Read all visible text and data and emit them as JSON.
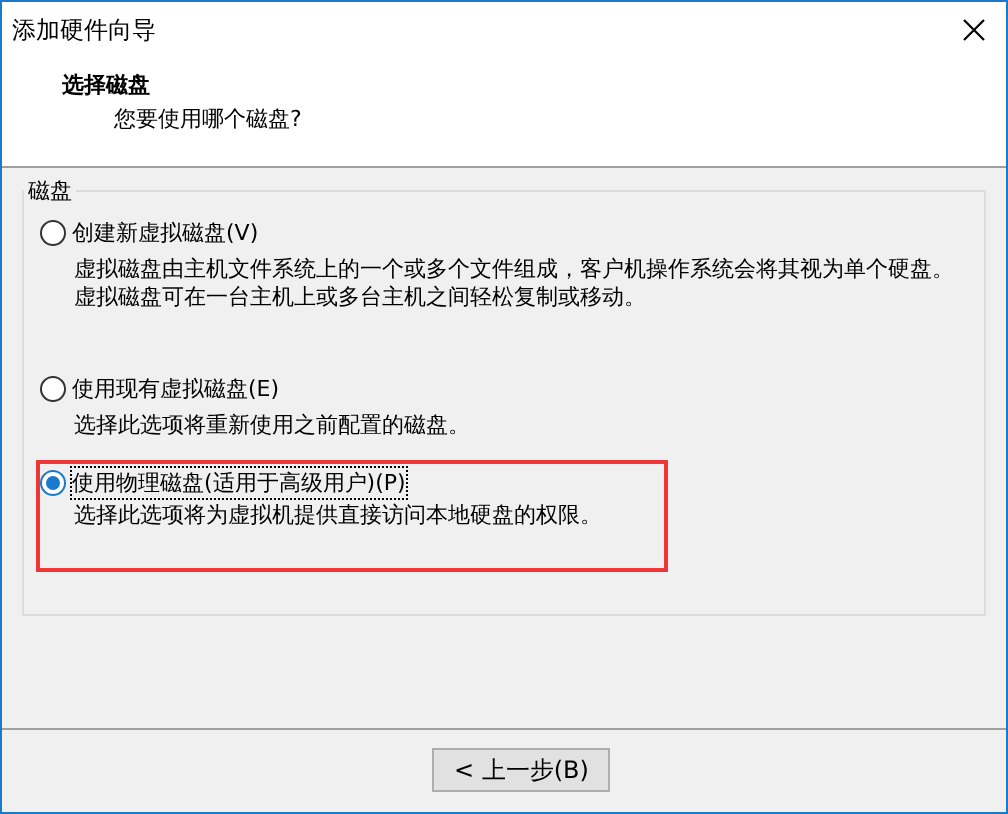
{
  "window": {
    "title": "添加硬件向导"
  },
  "header": {
    "title": "选择磁盘",
    "subtitle": "您要使用哪个磁盘?"
  },
  "group": {
    "label": "磁盘",
    "options": [
      {
        "label": "创建新虚拟磁盘(V)",
        "description": "虚拟磁盘由主机文件系统上的一个或多个文件组成，客户机操作系统会将其视为单个硬盘。虚拟磁盘可在一台主机上或多台主机之间轻松复制或移动。",
        "selected": false,
        "highlighted": false
      },
      {
        "label": "使用现有虚拟磁盘(E)",
        "description": "选择此选项将重新使用之前配置的磁盘。",
        "selected": false,
        "highlighted": false
      },
      {
        "label": "使用物理磁盘(适用于高级用户)(P)",
        "description": "选择此选项将为虚拟机提供直接访问本地硬盘的权限。",
        "selected": true,
        "highlighted": true
      }
    ]
  },
  "buttons": [
    "< 上一步(B)"
  ]
}
